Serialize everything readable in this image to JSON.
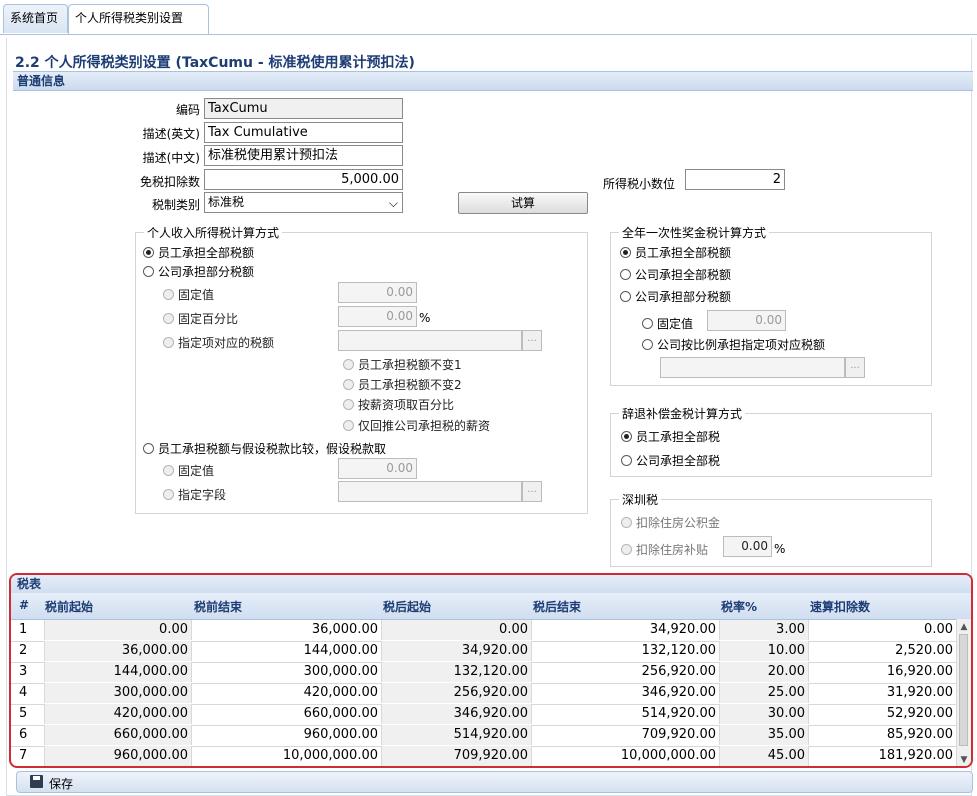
{
  "tabs": [
    {
      "label": "系统首页"
    },
    {
      "label": "个人所得税类别设置"
    }
  ],
  "page_title": "2.2 个人所得税类别设置 (TaxCumu - 标准税使用累计预扣法)",
  "section_general": "普通信息",
  "form": {
    "code_label": "编码",
    "code_value": "TaxCumu",
    "desc_en_label": "描述(英文)",
    "desc_en_value": "Tax Cumulative",
    "desc_cn_label": "描述(中文)",
    "desc_cn_value": "标准税使用累计预扣法",
    "exempt_label": "免税扣除数",
    "exempt_value": "5,000.00",
    "taxtype_label": "税制类别",
    "taxtype_value": "标准税",
    "calc_button": "试算",
    "decimals_label": "所得税小数位",
    "decimals_value": "2"
  },
  "personal_tax": {
    "legend": "个人收入所得税计算方式",
    "opt_employee_all": "员工承担全部税额",
    "opt_company_partial": "公司承担部分税额",
    "fixed_label": "固定值",
    "fixed_value": "0.00",
    "fixed_pct_label": "固定百分比",
    "fixed_pct_value": "0.00",
    "pct_sign": "%",
    "specified_label": "指定项对应的税额",
    "sub1": "员工承担税额不变1",
    "sub2": "员工承担税额不变2",
    "sub3": "按薪资项取百分比",
    "sub4": "仅回推公司承担税的薪资",
    "opt_compare": "员工承担税额与假设税款比较，假设税款取",
    "cmp_fixed_label": "固定值",
    "cmp_fixed_value": "0.00",
    "cmp_field_label": "指定字段",
    "dots": "..."
  },
  "bonus_tax": {
    "legend": "全年一次性奖金税计算方式",
    "opt_employee_all": "员工承担全部税额",
    "opt_company_all": "公司承担全部税额",
    "opt_company_partial": "公司承担部分税额",
    "fixed_label": "固定值",
    "fixed_value": "0.00",
    "ratio_label": "公司按比例承担指定项对应税额",
    "dots": "..."
  },
  "severance_tax": {
    "legend": "辞退补偿金税计算方式",
    "opt_employee_all": "员工承担全部税",
    "opt_company_all": "公司承担全部税"
  },
  "shenzhen_tax": {
    "legend": "深圳税",
    "housing_fund": "扣除住房公积金",
    "housing_allowance": "扣除住房补贴",
    "housing_allowance_value": "0.00",
    "pct_sign": "%"
  },
  "tax_table": {
    "title": "税表",
    "headers": [
      "#",
      "税前起始",
      "税前结束",
      "税后起始",
      "税后结束",
      "税率%",
      "速算扣除数"
    ],
    "rows": [
      [
        "1",
        "0.00",
        "36,000.00",
        "0.00",
        "34,920.00",
        "3.00",
        "0.00"
      ],
      [
        "2",
        "36,000.00",
        "144,000.00",
        "34,920.00",
        "132,120.00",
        "10.00",
        "2,520.00"
      ],
      [
        "3",
        "144,000.00",
        "300,000.00",
        "132,120.00",
        "256,920.00",
        "20.00",
        "16,920.00"
      ],
      [
        "4",
        "300,000.00",
        "420,000.00",
        "256,920.00",
        "346,920.00",
        "25.00",
        "31,920.00"
      ],
      [
        "5",
        "420,000.00",
        "660,000.00",
        "346,920.00",
        "514,920.00",
        "30.00",
        "52,920.00"
      ],
      [
        "6",
        "660,000.00",
        "960,000.00",
        "514,920.00",
        "709,920.00",
        "35.00",
        "85,920.00"
      ],
      [
        "7",
        "960,000.00",
        "10,000,000.00",
        "709,920.00",
        "10,000,000.00",
        "45.00",
        "181,920.00"
      ]
    ]
  },
  "save_label": "保存"
}
